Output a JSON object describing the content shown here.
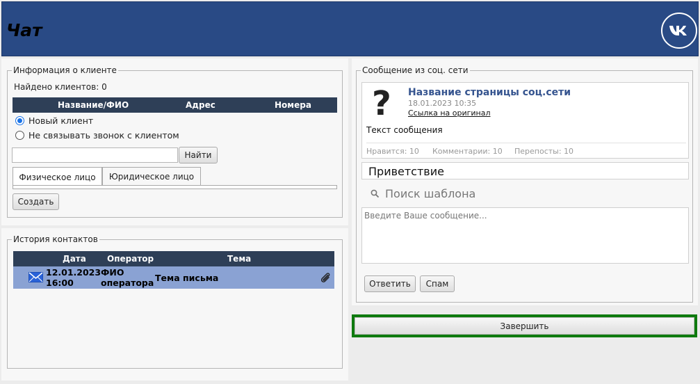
{
  "header": {
    "title": "Чат",
    "logo_icon": "vk-logo-icon",
    "bg_color": "#294a85"
  },
  "client_info": {
    "legend": "Информация о клиенте",
    "found_text": "Найдено клиентов: 0",
    "columns": [
      "Название/ФИО",
      "Адрес",
      "Номера"
    ],
    "radio_new": "Новый клиент",
    "radio_no_link": "Не связывать звонок с клиентом",
    "search_value": "",
    "find_button": "Найти",
    "tabs": [
      "Физическое лицо",
      "Юридическое лицо"
    ],
    "create_button": "Создать"
  },
  "history": {
    "legend": "История контактов",
    "columns": [
      "Дата",
      "Оператор",
      "Тема"
    ],
    "rows": [
      {
        "icon": "mail-icon",
        "date": "12.01.2023",
        "time": "16:00",
        "operator_line1": "ФИО",
        "operator_line2": "оператора",
        "subject": "Тема письма",
        "attach_icon": "paperclip-icon"
      }
    ],
    "row_color": "#8aa2d3"
  },
  "social": {
    "legend": "Сообщение из соц. сети",
    "avatar_icon": "question-mark-icon",
    "page_name": "Название страницы соц.сети",
    "date": "18.01.2023 10:35",
    "link": "Ссылка на оригинал",
    "message": "Текст сообщения",
    "likes": "Нравится: 10",
    "comments": "Комментарии: 10",
    "reposts": "Перепосты: 10",
    "greeting": "Приветствие",
    "template_search": "Поиск шаблона",
    "reply_placeholder": "Введите Ваше сообщение...",
    "reply_button": "Ответить",
    "spam_button": "Спам"
  },
  "finish": {
    "label": "Завершить",
    "border_color": "#0e7a0e"
  }
}
